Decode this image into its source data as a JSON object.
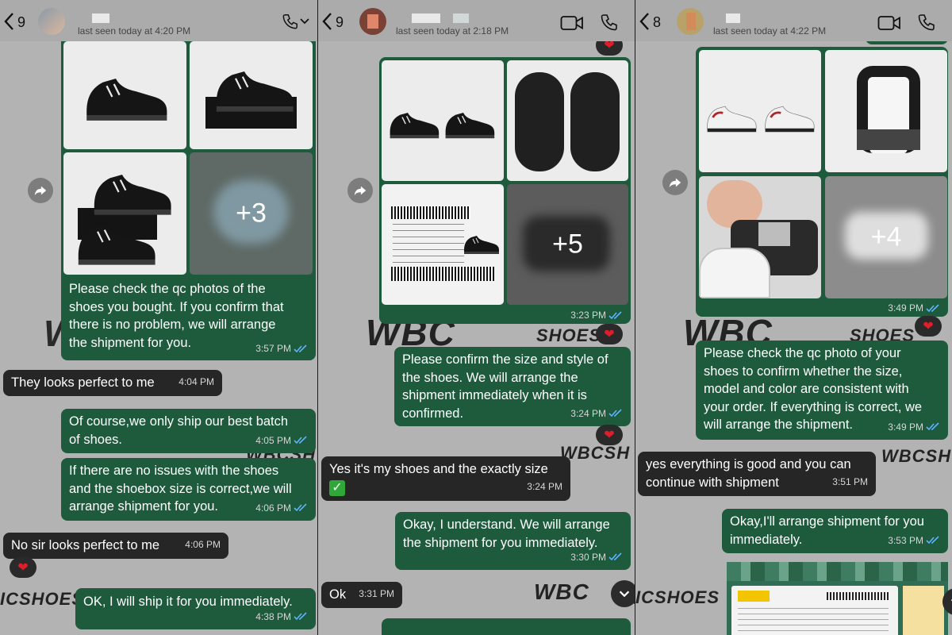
{
  "colors": {
    "outgoing": "#1d5b3c",
    "incoming": "#262626",
    "background": "#b3b3b3",
    "tick": "#5fb3ff",
    "heart": "#e01d2b"
  },
  "icons": {
    "back": "chevron-left-icon",
    "call": "phone-icon",
    "video": "video-icon",
    "forward": "forward-icon",
    "scroll": "chevron-down-icon",
    "reaction": "heart-icon"
  },
  "watermark": {
    "brand": "WBC",
    "shoes": "SHOES",
    "short": "WBCSH",
    "cut": "ICSHOES"
  },
  "panels": [
    {
      "header": {
        "unread": "9",
        "last_seen": "last seen today at 4:20 PM"
      },
      "photo": {
        "more": "+3"
      },
      "messages": [
        {
          "text": "Please check the qc photos of the\nshoes you bought. If you confirm that\nthere is no problem, we will arrange\nthe shipment for you.",
          "time": "3:57 PM"
        },
        {
          "text": "They looks perfect to me",
          "time": "4:04 PM"
        },
        {
          "text": "Of course,we only ship our best batch\nof shoes.",
          "time": "4:05 PM"
        },
        {
          "text": "If there are no issues with the shoes\nand the shoebox size is correct,we will\narrange shipment for you.",
          "time": "4:06 PM"
        },
        {
          "text": "No sir looks perfect to me",
          "time": "4:06 PM"
        },
        {
          "text": "OK, I will ship it for you immediately.",
          "time": "4:38 PM"
        }
      ]
    },
    {
      "header": {
        "unread": "9",
        "last_seen": "last seen today at 2:18 PM"
      },
      "photo": {
        "more": "+5",
        "time": "3:23 PM"
      },
      "messages": [
        {
          "text": "Please confirm the size and style of\nthe shoes. We will arrange the\nshipment immediately when it is\nconfirmed.",
          "time": "3:24 PM"
        },
        {
          "text": "Yes it's my shoes and the exactly size",
          "time": "3:24 PM"
        },
        {
          "text": "Okay, I understand. We will arrange\nthe shipment for you immediately.",
          "time": "3:30 PM"
        },
        {
          "text": "Ok",
          "time": "3:31 PM"
        }
      ]
    },
    {
      "header": {
        "unread": "8",
        "last_seen": "last seen today at 4:22 PM"
      },
      "photo": {
        "more": "+4",
        "time": "3:49 PM"
      },
      "messages": [
        {
          "text": "Please check the qc photo of your\nshoes to confirm whether the size,\nmodel and color are consistent with\nyour order. If everything is correct, we\nwill arrange the shipment.",
          "time": "3:49 PM"
        },
        {
          "text": "yes everything is good and you can\ncontinue with shipment",
          "time": "3:51 PM"
        },
        {
          "text": "Okay,I'll arrange shipment for you\nimmediately.",
          "time": "3:53 PM"
        }
      ]
    }
  ]
}
